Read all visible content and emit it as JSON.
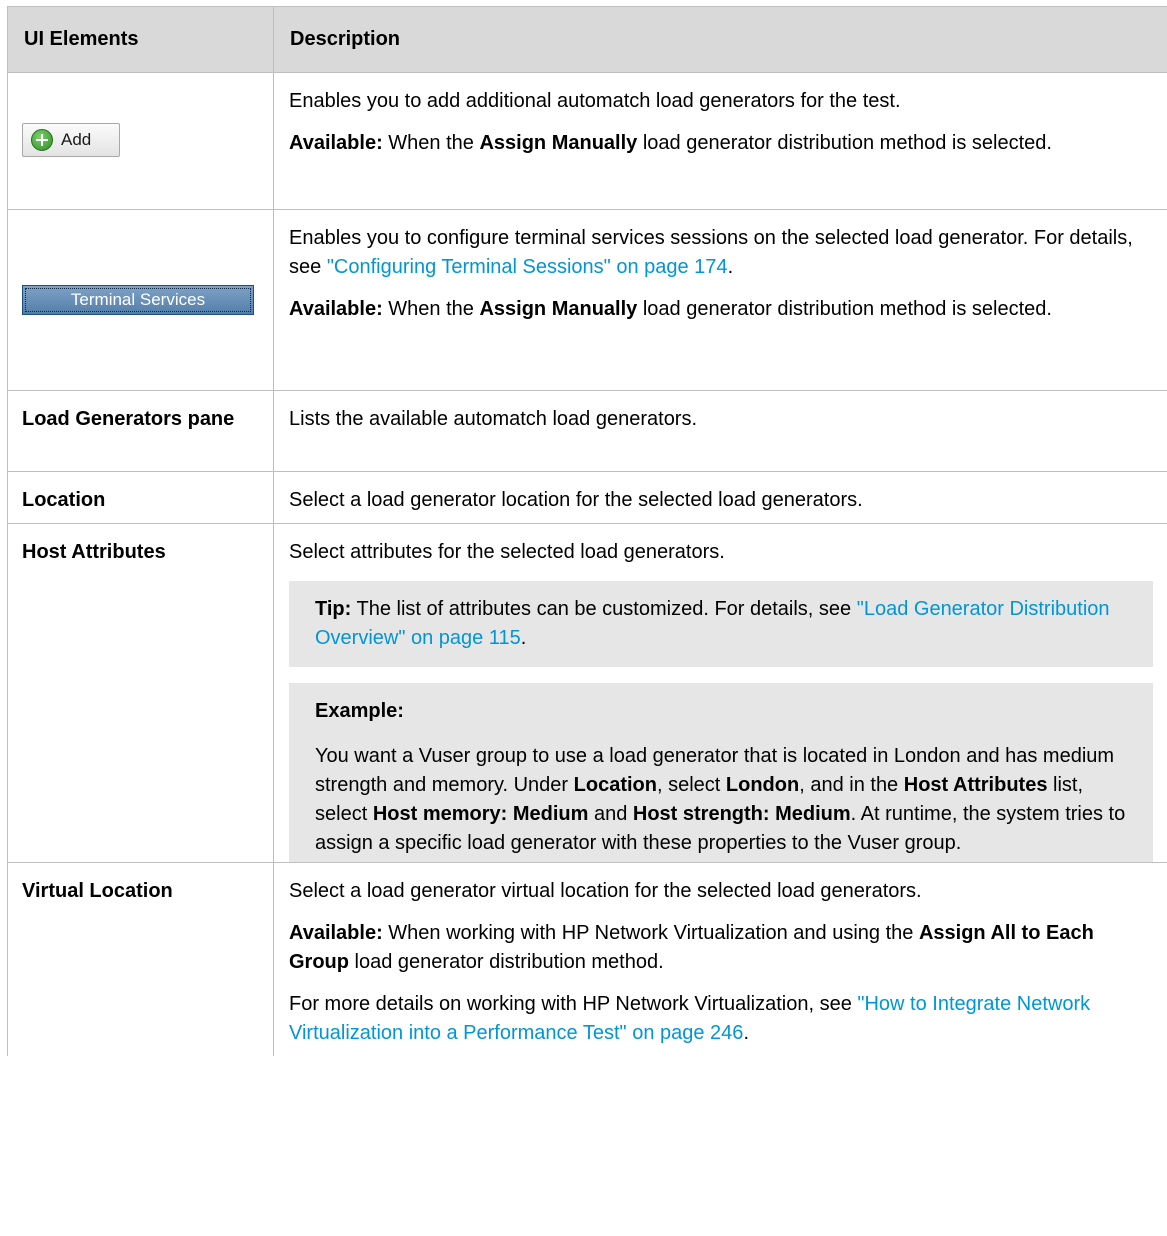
{
  "header": {
    "col1": "UI Elements",
    "col2": "Description"
  },
  "rows": {
    "add": {
      "button_label": "Add",
      "icon": "green-plus-circle-icon",
      "desc": "Enables you to add additional automatch load generators for the test.",
      "avail_label": "Available:",
      "avail_pre": " When the ",
      "avail_bold": "Assign Manually",
      "avail_post": " load generator distribution method is selected."
    },
    "terminal": {
      "button_label": "Terminal Services",
      "desc_pre": "Enables you to configure terminal services sessions on the selected load generator. For details, see ",
      "desc_link": "\"Configuring Terminal Sessions\" on page 174",
      "desc_post": ".",
      "avail_label": "Available:",
      "avail_pre": " When the ",
      "avail_bold": "Assign Manually",
      "avail_post": " load generator distribution method is selected."
    },
    "lg_pane": {
      "name": "Load Generators pane",
      "desc": "Lists the available automatch load generators."
    },
    "location": {
      "name": "Location",
      "desc": "Select a load generator location for the selected load generators."
    },
    "host_attributes": {
      "name": "Host Attributes",
      "desc": "Select attributes for the selected load generators.",
      "tip_label": "Tip:",
      "tip_pre": " The list of attributes can be customized. For details, see ",
      "tip_link": "\"Load Generator Distribution Overview\" on page 115",
      "tip_post": ".",
      "example_label": "Example:",
      "ex_t1": "You want a Vuser group to use a load generator that is located in London and has medium strength and memory. Under ",
      "ex_b1": "Location",
      "ex_t2": ", select ",
      "ex_b2": "London",
      "ex_t3": ", and in the ",
      "ex_b3": "Host Attributes",
      "ex_t4": " list, select ",
      "ex_b4": "Host memory: Medium",
      "ex_t5": " and ",
      "ex_b5": "Host strength: Medium",
      "ex_t6": ". At runtime, the system tries to assign a specific load generator with these properties to the Vuser group."
    },
    "virtual_location": {
      "name": "Virtual Location",
      "desc": "Select a load generator virtual location for the selected load generators.",
      "avail_label": "Available:",
      "avail_pre": " When working with HP Network Virtualization and using the ",
      "avail_bold": "Assign All to Each Group",
      "avail_post": " load generator distribution method.",
      "more_pre": "For more details on working with HP Network Virtualization, see ",
      "more_link": "\"How to Integrate Network Virtualization into a Performance Test\" on page 246",
      "more_post": "."
    }
  },
  "colors": {
    "link": "#0096d6",
    "header_bg": "#d9d9d9",
    "note_bg": "#e6e6e6",
    "border": "#bfbfbf"
  }
}
